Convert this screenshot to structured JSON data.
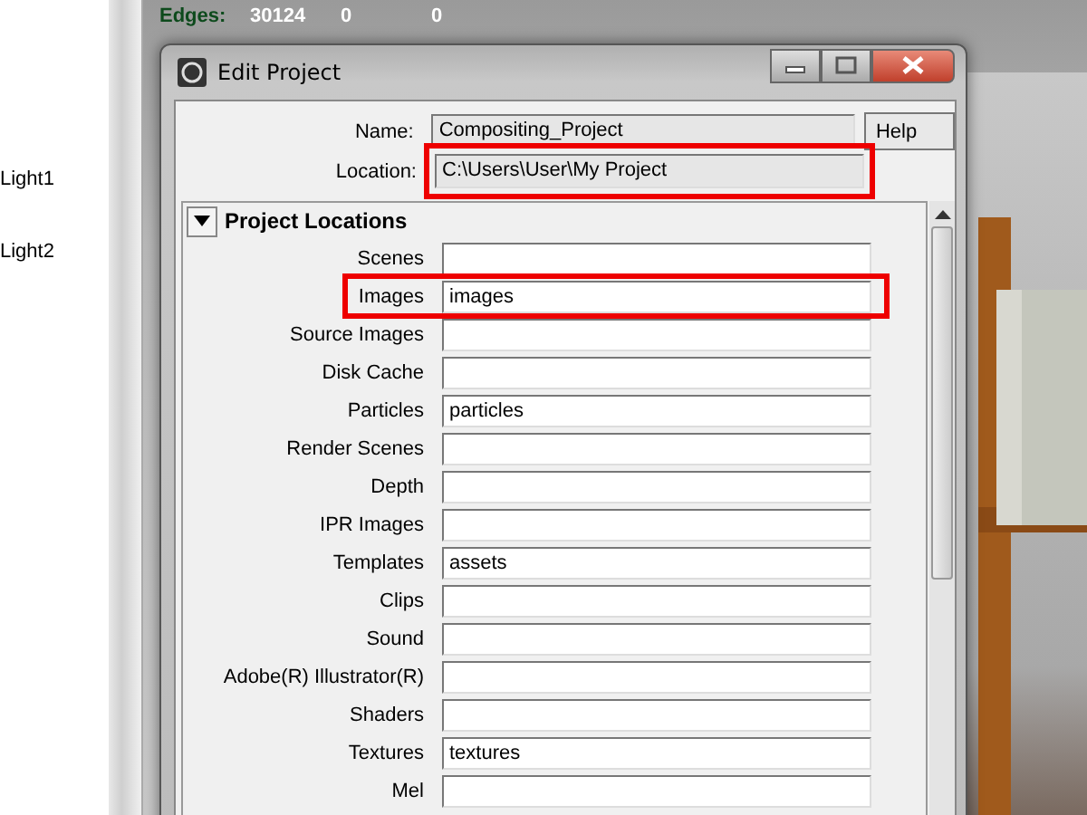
{
  "outliner": {
    "items": [
      "Light1",
      "Light2"
    ]
  },
  "heads_up": {
    "label": "Edges:",
    "values": [
      "30124",
      "0",
      "0"
    ]
  },
  "window": {
    "title": "Edit Project"
  },
  "name_field": {
    "label": "Name:",
    "value": "Compositing_Project",
    "highlighted": false
  },
  "help_button": "Help",
  "location_field": {
    "label": "Location:",
    "value": "C:\\Users\\User\\My Project",
    "highlighted": true
  },
  "section": {
    "title": "Project Locations",
    "expanded": true,
    "fields": [
      {
        "label": "Scenes",
        "highlighted": false
      },
      {
        "label": "Images",
        "value": "images",
        "highlighted": true
      },
      {
        "label": "Source Images",
        "highlighted": false
      },
      {
        "label": "Disk Cache",
        "highlighted": false
      },
      {
        "label": "Particles",
        "value": "particles",
        "highlighted": false
      },
      {
        "label": "Render Scenes",
        "highlighted": false
      },
      {
        "label": "Depth",
        "highlighted": false
      },
      {
        "label": "IPR Images",
        "highlighted": false
      },
      {
        "label": "Templates",
        "value": "assets",
        "highlighted": false
      },
      {
        "label": "Clips",
        "highlighted": false
      },
      {
        "label": "Sound",
        "highlighted": false
      },
      {
        "label": "Adobe(R) Illustrator(R)",
        "highlighted": false
      },
      {
        "label": "Shaders",
        "highlighted": false
      },
      {
        "label": "Textures",
        "value": "textures",
        "highlighted": false
      },
      {
        "label": "Mel",
        "highlighted": false
      }
    ]
  }
}
